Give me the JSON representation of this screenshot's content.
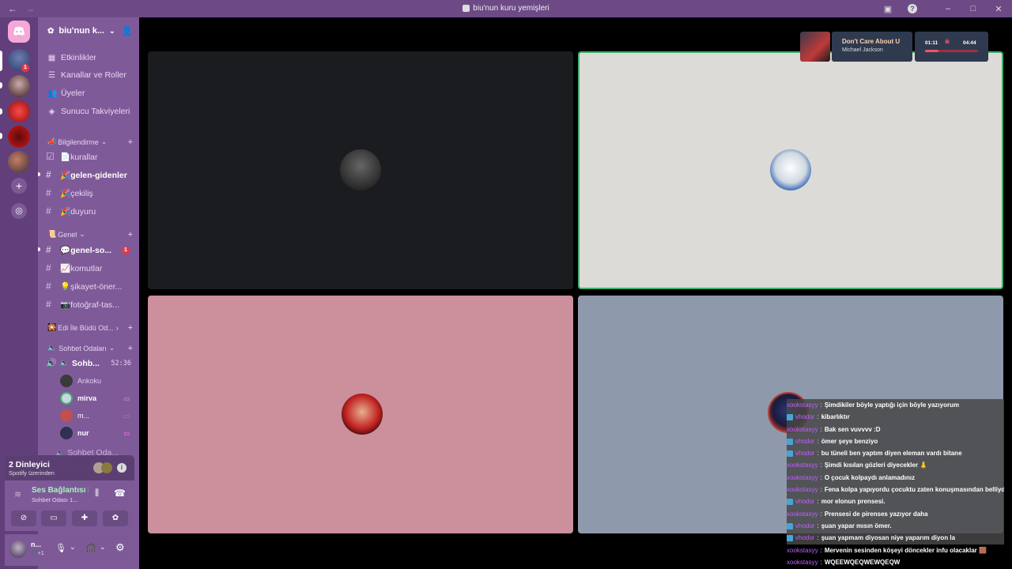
{
  "window": {
    "title": "biu'nun kuru yemişleri",
    "back": "←",
    "forward": "→",
    "controls": [
      "–",
      "□",
      "✕"
    ]
  },
  "server": {
    "name": "biu'nun k...",
    "menu": [
      {
        "label": "Etkinlikler",
        "icon": "calendar-icon"
      },
      {
        "label": "Kanallar ve Roller",
        "icon": "list-icon"
      },
      {
        "label": "Üyeler",
        "icon": "members-icon"
      },
      {
        "label": "Sunucu Takviyeleri",
        "icon": "boost-icon"
      }
    ],
    "categories": {
      "info": "Bilgilendirme",
      "general": "Genel",
      "edi": "Edi İle Büdü Od...",
      "voice": "Sohbet Odaları"
    },
    "info_channels": [
      "📄kurallar",
      "🎉gelen-gidenler",
      "🎉çekiliş",
      "🎉duyuru"
    ],
    "general_channels": [
      "💬genel-so...",
      "📈komutlar",
      "💡şikayet-öner...",
      "📷fotoğraf-tas..."
    ],
    "general_badge": "1",
    "server_badge": "1",
    "voice_channel": {
      "name": "Sohb...",
      "time": "52:36"
    },
    "voice_users": [
      "Ankoku",
      "mirva",
      "m...",
      "nur"
    ],
    "voice_channel_2": "Sohbet Oda..."
  },
  "listeners": {
    "title": "2 Dinleyici",
    "subtitle": "Spotify üzerinden"
  },
  "voice_connection": {
    "title": "Ses Bağlantısı K",
    "subtitle": "Sohbet Odası 1..."
  },
  "user": {
    "name": "n...",
    "status": "🎵+1"
  },
  "now_playing": {
    "song": "Don't Care About U",
    "artist": "Michael Jackson",
    "elapsed": "01:11",
    "total": "04:44",
    "progress": 0.25
  },
  "colors": {
    "tile1": "#1b1c20",
    "tile2": "#dddbd7",
    "tile3": "#cc8f9c",
    "tile4": "#8e9aab",
    "speaking": "#3fb06f"
  },
  "chat": [
    {
      "user": "xooksta",
      "name": "xookstasyy",
      "text": "Şimdikiler böyle yaptığı için böyle yazıyorum"
    },
    {
      "user": "vhodor",
      "name": "vhodor",
      "text": "kibarlıktır"
    },
    {
      "user": "xooksta",
      "name": "xookstasyy",
      "text": "Bak sen vuvvvv :D"
    },
    {
      "user": "vhodor",
      "name": "vhodor",
      "text": "ömer şeye benziyo"
    },
    {
      "user": "vhodor",
      "name": "vhodor",
      "text": "bu tüneli ben yaptım diyen eleman vardı bitane"
    },
    {
      "user": "xooksta",
      "name": "xookstasyy",
      "text": "Şimdi kısılan gözleri diyecekler 👃"
    },
    {
      "user": "xooksta",
      "name": "xookstasyy",
      "text": "O çocuk kolpaydı anlamadınız"
    },
    {
      "user": "xooksta",
      "name": "xookstasyy",
      "text": "Fena kolpa yapıyordu çocuktu zaten konuşmasından belliydi"
    },
    {
      "user": "vhodor",
      "name": "vhodor",
      "text": "mor elonun prensesi."
    },
    {
      "user": "xooksta",
      "name": "xookstasyy",
      "text": "Prensesi de pirenses yazıyor daha"
    },
    {
      "user": "vhodor",
      "name": "vhodor",
      "text": "şuan yapar mısın ömer."
    },
    {
      "user": "vhodor",
      "name": "vhodor",
      "text": "şuan yapmam diyosan niye yaparım diyon la"
    },
    {
      "user": "xooksta",
      "name": "xookstasyy",
      "text": "Mervenin sesinden köşeyi döncekler infu olacaklar 🟫"
    },
    {
      "user": "xooksta",
      "name": "xookstasyy",
      "text": "WQEEWQEQWEWQEQW"
    }
  ]
}
